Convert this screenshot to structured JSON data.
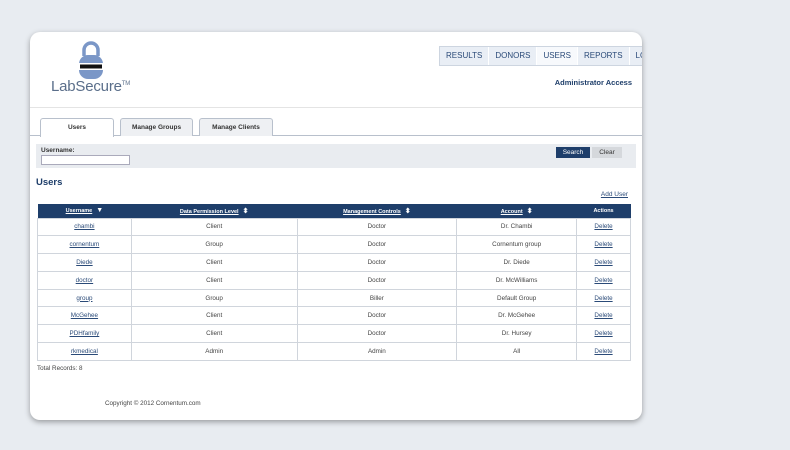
{
  "logo": {
    "text": "LabSecure",
    "tm": "TM"
  },
  "nav": [
    {
      "label": "Results",
      "active": false
    },
    {
      "label": "Donors",
      "active": false
    },
    {
      "label": "Users",
      "active": true
    },
    {
      "label": "Reports",
      "active": false
    },
    {
      "label": "Log Out",
      "active": false
    }
  ],
  "access_label": "Administrator Access",
  "tabs": [
    {
      "label": "Users",
      "active": true
    },
    {
      "label": "Manage Groups",
      "active": false
    },
    {
      "label": "Manage Clients",
      "active": false
    }
  ],
  "search": {
    "label": "Username:",
    "value": "",
    "placeholder": "",
    "search_button": "Search",
    "clear_button": "Clear"
  },
  "section_title": "Users",
  "add_user_label": "Add User",
  "table": {
    "columns": [
      {
        "label": "Username",
        "sort": "desc"
      },
      {
        "label": "Data Permission Level",
        "sort": "both"
      },
      {
        "label": "Management Controls",
        "sort": "both"
      },
      {
        "label": "Account",
        "sort": "both"
      },
      {
        "label": "Actions",
        "sort": "none"
      }
    ],
    "rows": [
      {
        "username": "chambi",
        "permission": "Client",
        "controls": "Doctor",
        "account": "Dr. Chambi",
        "action": "Delete"
      },
      {
        "username": "cornentum",
        "permission": "Group",
        "controls": "Doctor",
        "account": "Cornentum group",
        "action": "Delete"
      },
      {
        "username": "Diede",
        "permission": "Client",
        "controls": "Doctor",
        "account": "Dr. Diede",
        "action": "Delete"
      },
      {
        "username": "doctor",
        "permission": "Client",
        "controls": "Doctor",
        "account": "Dr. McWilliams",
        "action": "Delete"
      },
      {
        "username": "group",
        "permission": "Group",
        "controls": "Biller",
        "account": "Default Group",
        "action": "Delete"
      },
      {
        "username": "McGehee",
        "permission": "Client",
        "controls": "Doctor",
        "account": "Dr. McGehee",
        "action": "Delete"
      },
      {
        "username": "PDHfamily",
        "permission": "Client",
        "controls": "Doctor",
        "account": "Dr. Hursey",
        "action": "Delete"
      },
      {
        "username": "rkmedical",
        "permission": "Admin",
        "controls": "Admin",
        "account": "All",
        "action": "Delete"
      }
    ]
  },
  "total_records": "Total Records: 8",
  "copyright": "Copyright © 2012 Cornentum.com",
  "colors": {
    "brand_navy": "#1e3e6a",
    "link_blue": "#2a4a78",
    "background": "#e8ecf1"
  }
}
